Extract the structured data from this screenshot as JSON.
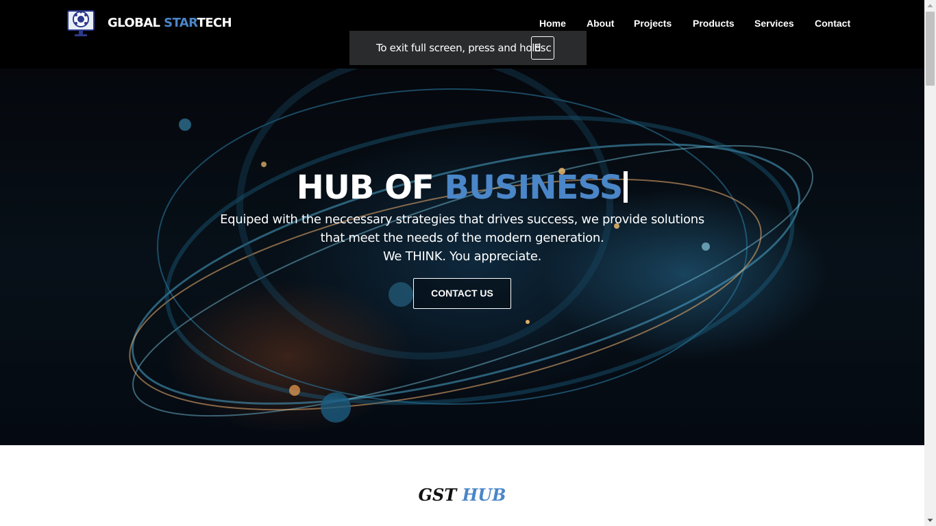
{
  "header": {
    "brand_prefix": "GLOBAL",
    "brand_accent": "STAR",
    "brand_suffix": "TECH",
    "nav": [
      {
        "label": "Home"
      },
      {
        "label": "About"
      },
      {
        "label": "Projects"
      },
      {
        "label": "Products"
      },
      {
        "label": "Services"
      },
      {
        "label": "Contact"
      }
    ]
  },
  "fullscreen_toast": {
    "message": "To exit full screen, press and hold",
    "key": "Esc"
  },
  "hero": {
    "title_prefix": "HUB OF",
    "title_accent": "BUSINESS",
    "subtitle_lines": [
      "Equiped with the neccessary strategies that drives success, we provide solutions",
      "that meet the needs of the modern generation.",
      "We THINK. You appreciate."
    ],
    "cta_label": "CONTACT US"
  },
  "section": {
    "title_prefix": "GST",
    "title_accent": "HUB"
  },
  "colors": {
    "accent": "#4a86c8",
    "header_bg": "#000000",
    "toast_bg": "#2a2b2d"
  },
  "icons": {
    "logo": "globe-monitor-logo",
    "scroll_up": "triangle-up-icon",
    "scroll_down": "triangle-down-icon"
  }
}
